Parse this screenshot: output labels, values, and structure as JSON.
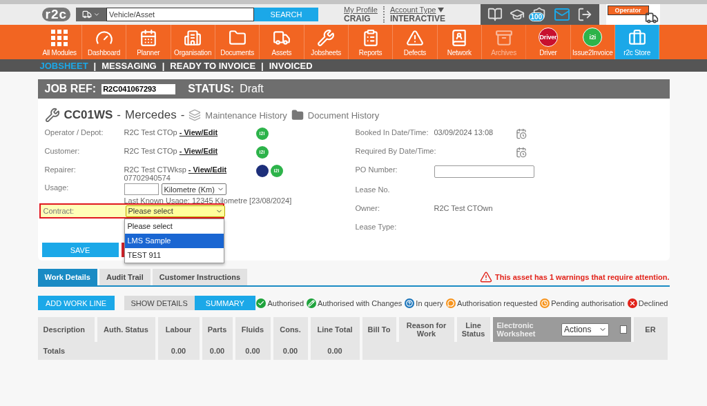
{
  "header": {
    "logo": "r2c",
    "search": {
      "placeholder": "Vehicle/Asset",
      "button": "SEARCH"
    },
    "profile": {
      "link": "My Profile",
      "name": "CRAIG"
    },
    "account": {
      "link": "Account Type",
      "value": "INTERACTIVE"
    },
    "notification_count": "100",
    "operator": "Operator"
  },
  "nav": {
    "items": [
      {
        "label": "All Modules",
        "kind": "icon",
        "selected": false,
        "disabled": false
      },
      {
        "label": "Dashboard",
        "kind": "icon",
        "selected": false,
        "disabled": false
      },
      {
        "label": "Planner",
        "kind": "icon",
        "selected": false,
        "disabled": false
      },
      {
        "label": "Organisation",
        "kind": "icon",
        "selected": false,
        "disabled": false
      },
      {
        "label": "Documents",
        "kind": "icon",
        "selected": false,
        "disabled": false
      },
      {
        "label": "Assets",
        "kind": "icon",
        "selected": false,
        "disabled": false
      },
      {
        "label": "Jobsheets",
        "kind": "icon",
        "selected": false,
        "disabled": false
      },
      {
        "label": "Reports",
        "kind": "icon",
        "selected": false,
        "disabled": false
      },
      {
        "label": "Defects",
        "kind": "icon",
        "selected": false,
        "disabled": false
      },
      {
        "label": "Network",
        "kind": "icon",
        "selected": false,
        "disabled": false
      },
      {
        "label": "Archives",
        "kind": "icon",
        "selected": false,
        "disabled": true
      },
      {
        "label": "Driver",
        "kind": "badge",
        "badge": "Driver",
        "color": "#c8102e",
        "selected": false,
        "disabled": false
      },
      {
        "label": "Issue2Invoice",
        "kind": "badge",
        "badge": "i2i",
        "color": "#2db34a",
        "selected": false,
        "disabled": false
      },
      {
        "label": "r2c Store",
        "kind": "icon",
        "selected": true,
        "disabled": false
      }
    ]
  },
  "subnav": [
    {
      "label": "JOBSHEET",
      "selected": true
    },
    {
      "label": "MESSAGING",
      "selected": false
    },
    {
      "label": "READY TO INVOICE",
      "selected": false
    },
    {
      "label": "INVOICED",
      "selected": false
    }
  ],
  "subnav_separator": "|",
  "job": {
    "ref_label": "JOB REF:",
    "ref": "R2C041067293",
    "status_label": "STATUS:",
    "status": "Draft"
  },
  "vehicle": {
    "reg": "CC01WS",
    "separator": "-",
    "make": "Mercedes",
    "links": [
      "Maintenance History",
      "Document History"
    ]
  },
  "left_fields": [
    {
      "kind": "party",
      "label": "Operator / Depot:",
      "value": "R2C Test CTOp",
      "link": "- View/Edit",
      "badges": [
        "i2i"
      ]
    },
    {
      "kind": "party",
      "label": "Customer:",
      "value": "R2C Test CTOp",
      "link": "- View/Edit",
      "badges": [
        "i2i"
      ]
    },
    {
      "kind": "party",
      "label": "Repairer:",
      "value": "R2C Test CTWksp",
      "link": "- View/Edit",
      "phone": "07702940574",
      "inspect": true,
      "badges": [
        "i2i"
      ]
    },
    {
      "kind": "usage",
      "label": "Usage:",
      "unit": "Kilometre (Km)",
      "note": "Last Known Usage: 12345 Kilometre [23/08/2024]"
    },
    {
      "kind": "select",
      "label": "Contract:",
      "value": "Please select",
      "error": true,
      "open": true,
      "options": [
        {
          "label": "Please select",
          "highlighted": false
        },
        {
          "label": "LMS Sample",
          "highlighted": true
        },
        {
          "label": "TEST 911",
          "highlighted": false
        }
      ]
    }
  ],
  "right_fields": [
    {
      "kind": "text",
      "label": "Booked In Date/Time:",
      "value": "03/09/2024 13:08",
      "calendar": true
    },
    {
      "kind": "text",
      "label": "Required By Date/Time:",
      "calendar": true
    },
    {
      "kind": "input",
      "label": "PO Number:"
    },
    {
      "kind": "text",
      "label": "Lease No."
    },
    {
      "kind": "text",
      "label": "Owner:",
      "value": "R2C Test CTOwn"
    },
    {
      "kind": "text",
      "label": "Lease Type:"
    }
  ],
  "form_buttons": [
    {
      "kind": "save",
      "label": "SAVE"
    },
    {
      "kind": "danger"
    }
  ],
  "tabs": [
    {
      "label": "Work Details",
      "selected": true
    },
    {
      "label": "Audit Trail",
      "selected": false
    },
    {
      "label": "Customer Instructions",
      "selected": false
    }
  ],
  "warning": "This asset has 1 warnings that require attention.",
  "toolbar": {
    "add": "ADD WORK LINE",
    "views": [
      {
        "label": "SHOW DETAILS",
        "selected": false
      },
      {
        "label": "SUMMARY",
        "selected": true
      }
    ]
  },
  "legend": [
    {
      "kind": "check",
      "label": "Authorised",
      "color": "#1ea33c"
    },
    {
      "kind": "pencil",
      "label": "Authorised with Changes",
      "color": "#1ea33c"
    },
    {
      "kind": "question",
      "label": "In query",
      "color": "#1b75bb"
    },
    {
      "kind": "bubble",
      "label": "Authorisation requested",
      "color": "#f7941d"
    },
    {
      "kind": "clock",
      "label": "Pending authorisation",
      "color": "#f7941d"
    },
    {
      "kind": "cross",
      "label": "Declined",
      "color": "#e2231a"
    }
  ],
  "table": {
    "columns": [
      {
        "kind": "text",
        "label": "Description"
      },
      {
        "kind": "text",
        "label": "Auth. Status"
      },
      {
        "kind": "text",
        "label": "Labour"
      },
      {
        "kind": "text",
        "label": "Parts"
      },
      {
        "kind": "text",
        "label": "Fluids"
      },
      {
        "kind": "text",
        "label": "Cons."
      },
      {
        "kind": "text",
        "label": "Line Total"
      },
      {
        "kind": "text",
        "label": "Bill To"
      },
      {
        "kind": "text",
        "label": "Reason for Work"
      },
      {
        "kind": "text",
        "label": "Line Status"
      },
      {
        "kind": "worksheet",
        "label": "Electronic Worksheet",
        "select": "Actions",
        "checked": false
      },
      {
        "kind": "text",
        "label": "ER"
      }
    ],
    "totals": {
      "label": "Totals",
      "values": [
        "0.00",
        "0.00",
        "0.00",
        "0.00",
        "0.00"
      ]
    }
  }
}
